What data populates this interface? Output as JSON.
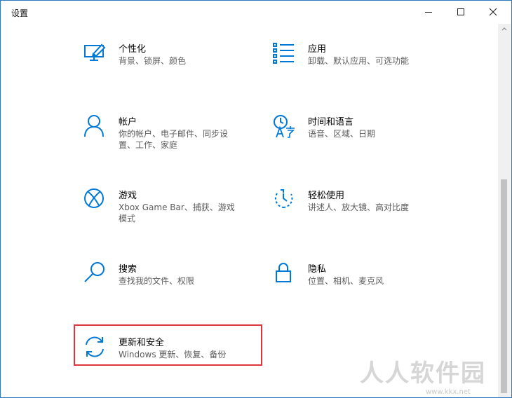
{
  "window": {
    "title": "设置",
    "controls": {
      "minimize": "minimize",
      "maximize": "maximize",
      "close": "close"
    }
  },
  "tiles": [
    {
      "name": "个性化",
      "desc": "背景、锁屏、颜色",
      "icon": "personalization-icon"
    },
    {
      "name": "应用",
      "desc": "卸载、默认应用、可选功能",
      "icon": "apps-icon"
    },
    {
      "name": "帐户",
      "desc": "你的帐户、电子邮件、同步设置、工作、家庭",
      "icon": "account-icon"
    },
    {
      "name": "时间和语言",
      "desc": "语音、区域、日期",
      "icon": "time-language-icon"
    },
    {
      "name": "游戏",
      "desc": "Xbox Game Bar、捕获、游戏模式",
      "icon": "xbox-icon"
    },
    {
      "name": "轻松使用",
      "desc": "讲述人、放大镜、高对比度",
      "icon": "ease-of-access-icon"
    },
    {
      "name": "搜索",
      "desc": "查找我的文件、权限",
      "icon": "search-icon"
    },
    {
      "name": "隐私",
      "desc": "位置、相机、麦克风",
      "icon": "lock-icon"
    },
    {
      "name": "更新和安全",
      "desc": "Windows 更新、恢复、备份",
      "icon": "update-sync-icon"
    }
  ],
  "watermark": {
    "text": "人人软件园",
    "url": "www.kkx.net"
  },
  "colors": {
    "accent": "#0078d7",
    "highlight": "#e0343b",
    "window_border": "#2b79c2"
  }
}
